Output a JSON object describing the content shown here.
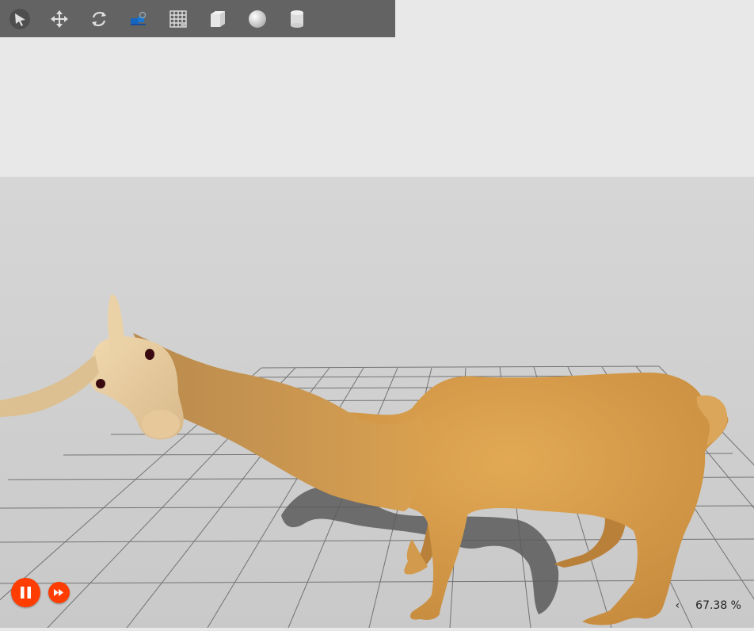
{
  "toolbar": {
    "tools": [
      {
        "name": "select-tool",
        "icon": "arrow-cursor-icon"
      },
      {
        "name": "translate-tool",
        "icon": "move-arrows-icon"
      },
      {
        "name": "rotate-tool",
        "icon": "rotate-icon"
      },
      {
        "name": "scale-tool",
        "icon": "scale-icon"
      },
      {
        "name": "grid-tool",
        "icon": "grid-icon"
      },
      {
        "name": "box-tool",
        "icon": "box-icon"
      },
      {
        "name": "sphere-tool",
        "icon": "sphere-icon"
      },
      {
        "name": "cylinder-tool",
        "icon": "cylinder-icon"
      }
    ]
  },
  "playback": {
    "pause_icon": "pause-icon",
    "step_icon": "fast-forward-icon",
    "accent": "#ff3d00"
  },
  "status": {
    "collapse_glyph": "‹",
    "real_time_factor": "67.38 %"
  },
  "colors": {
    "sky": "#e8e8e8",
    "ground": "#d0d0d0",
    "toolbar_bg": "#636363",
    "body": "#d9a04f",
    "head": "#e8cca0"
  }
}
